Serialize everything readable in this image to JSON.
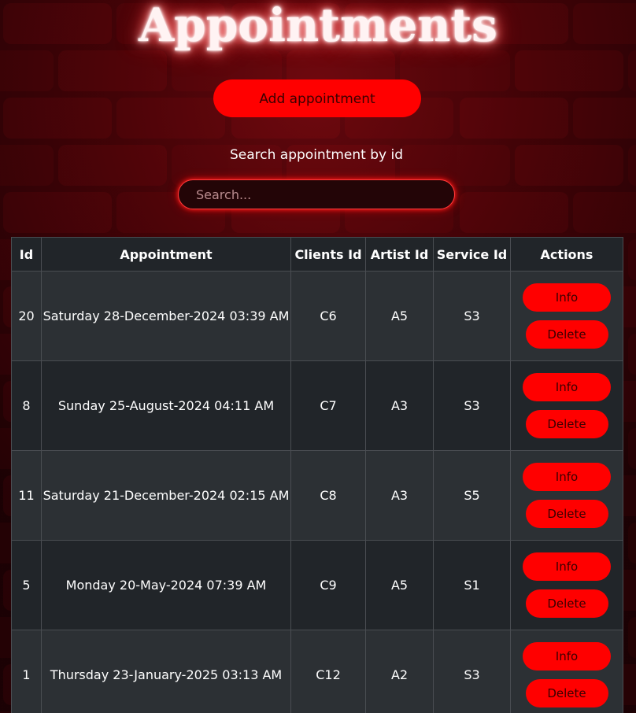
{
  "page": {
    "title": "Appointments",
    "add_button_label": "Add appointment",
    "search_label": "Search appointment by id",
    "search_placeholder": "Search...",
    "search_value": ""
  },
  "colors": {
    "accent": "#ff0000",
    "table_header_bg": "#212529",
    "row_odd_bg": "#2c3034",
    "row_even_bg": "#212529",
    "background": "#1a0204"
  },
  "table": {
    "headers": [
      "Id",
      "Appointment",
      "Clients Id",
      "Artist Id",
      "Service Id",
      "Actions"
    ],
    "rows": [
      {
        "id": "20",
        "appointment": "Saturday 28-December-2024 03:39 AM",
        "client_id": "C6",
        "artist_id": "A5",
        "service_id": "S3",
        "info_label": "Info",
        "delete_label": "Delete"
      },
      {
        "id": "8",
        "appointment": "Sunday 25-August-2024 04:11 AM",
        "client_id": "C7",
        "artist_id": "A3",
        "service_id": "S3",
        "info_label": "Info",
        "delete_label": "Delete"
      },
      {
        "id": "11",
        "appointment": "Saturday 21-December-2024 02:15 AM",
        "client_id": "C8",
        "artist_id": "A3",
        "service_id": "S5",
        "info_label": "Info",
        "delete_label": "Delete"
      },
      {
        "id": "5",
        "appointment": "Monday 20-May-2024 07:39 AM",
        "client_id": "C9",
        "artist_id": "A5",
        "service_id": "S1",
        "info_label": "Info",
        "delete_label": "Delete"
      },
      {
        "id": "1",
        "appointment": "Thursday 23-January-2025 03:13 AM",
        "client_id": "C12",
        "artist_id": "A2",
        "service_id": "S3",
        "info_label": "Info",
        "delete_label": "Delete"
      }
    ]
  }
}
